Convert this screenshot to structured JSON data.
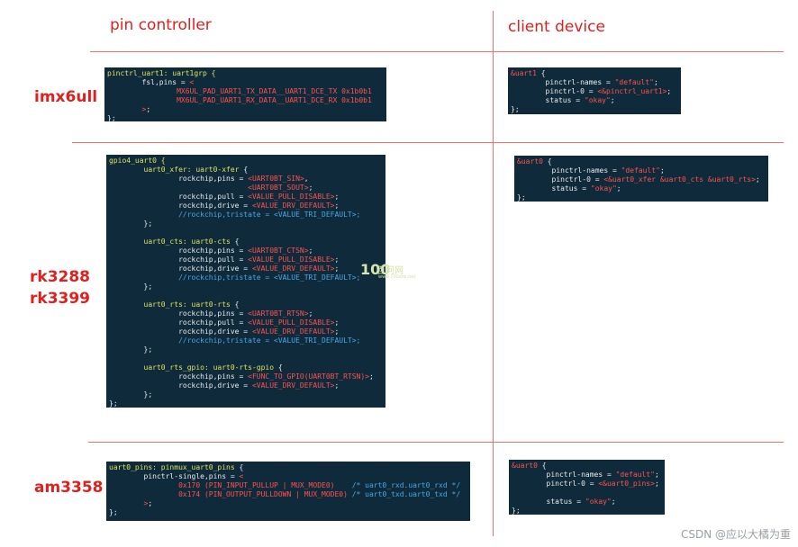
{
  "headers": {
    "left": "pin controller",
    "right": "client device"
  },
  "rows": [
    {
      "label_lines": [
        "imx6ull"
      ]
    },
    {
      "label_lines": [
        "rk3288",
        "rk3399"
      ]
    },
    {
      "label_lines": [
        "am3358"
      ]
    }
  ],
  "watermark": {
    "logo": "100",
    "text": "百问网",
    "url": "www.100ask.net"
  },
  "credit": "CSDN @应以大橘为重",
  "code_blocks": {
    "imx_pin": [
      [
        [
          "y",
          "pinctrl_uart1: uart1grp {"
        ]
      ],
      [
        [
          "w",
          "        fsl,pins = "
        ],
        [
          "r",
          "<"
        ]
      ],
      [
        [
          "r",
          "                MX6UL_PAD_UART1_TX_DATA__UART1_DCE_TX 0x1b0b1"
        ]
      ],
      [
        [
          "r",
          "                MX6UL_PAD_UART1_RX_DATA__UART1_DCE_RX 0x1b0b1"
        ]
      ],
      [
        [
          "r",
          "        >"
        ],
        [
          "w",
          ";"
        ]
      ],
      [
        [
          "w",
          "};"
        ]
      ]
    ],
    "imx_client": [
      [
        [
          "r",
          "&uart1"
        ],
        [
          "w",
          " {"
        ]
      ],
      [
        [
          "w",
          "        pinctrl-names = "
        ],
        [
          "r",
          "\"default\""
        ],
        [
          "w",
          ";"
        ]
      ],
      [
        [
          "w",
          "        pinctrl-0 = "
        ],
        [
          "r",
          "<&pinctrl_uart1>"
        ],
        [
          "w",
          ";"
        ]
      ],
      [
        [
          "w",
          "        status = "
        ],
        [
          "r",
          "\"okay\""
        ],
        [
          "w",
          ";"
        ]
      ],
      [
        [
          "w",
          "};"
        ]
      ]
    ],
    "rk_pin": [
      [
        [
          "y",
          "gpio4_uart0 {"
        ]
      ],
      [
        [
          "w",
          "        "
        ],
        [
          "y",
          "uart0_xfer: uart0-xfer"
        ],
        [
          "w",
          " {"
        ]
      ],
      [
        [
          "w",
          "                rockchip,pins = "
        ],
        [
          "r",
          "<UART0BT_SIN>"
        ],
        [
          "w",
          ","
        ]
      ],
      [
        [
          "w",
          "                                "
        ],
        [
          "r",
          "<UART0BT_SOUT>"
        ],
        [
          "w",
          ";"
        ]
      ],
      [
        [
          "w",
          "                rockchip,pull = "
        ],
        [
          "r",
          "<VALUE_PULL_DISABLE>"
        ],
        [
          "w",
          ";"
        ]
      ],
      [
        [
          "w",
          "                rockchip,drive = "
        ],
        [
          "r",
          "<VALUE_DRV_DEFAULT>"
        ],
        [
          "w",
          ";"
        ]
      ],
      [
        [
          "b",
          "                //rockchip,tristate = <VALUE_TRI_DEFAULT>;"
        ]
      ],
      [
        [
          "w",
          "        };"
        ]
      ],
      [
        [
          "w",
          ""
        ]
      ],
      [
        [
          "w",
          "        "
        ],
        [
          "y",
          "uart0_cts: uart0-cts"
        ],
        [
          "w",
          " {"
        ]
      ],
      [
        [
          "w",
          "                rockchip,pins = "
        ],
        [
          "r",
          "<UART0BT_CTSN>"
        ],
        [
          "w",
          ";"
        ]
      ],
      [
        [
          "w",
          "                rockchip,pull = "
        ],
        [
          "r",
          "<VALUE_PULL_DISABLE>"
        ],
        [
          "w",
          ";"
        ]
      ],
      [
        [
          "w",
          "                rockchip,drive = "
        ],
        [
          "r",
          "<VALUE_DRV_DEFAULT>"
        ],
        [
          "w",
          ";"
        ]
      ],
      [
        [
          "b",
          "                //rockchip,tristate = <VALUE_TRI_DEFAULT>;"
        ]
      ],
      [
        [
          "w",
          "        };"
        ]
      ],
      [
        [
          "w",
          ""
        ]
      ],
      [
        [
          "w",
          "        "
        ],
        [
          "y",
          "uart0_rts: uart0-rts"
        ],
        [
          "w",
          " {"
        ]
      ],
      [
        [
          "w",
          "                rockchip,pins = "
        ],
        [
          "r",
          "<UART0BT_RTSN>"
        ],
        [
          "w",
          ";"
        ]
      ],
      [
        [
          "w",
          "                rockchip,pull = "
        ],
        [
          "r",
          "<VALUE_PULL_DISABLE>"
        ],
        [
          "w",
          ";"
        ]
      ],
      [
        [
          "w",
          "                rockchip,drive = "
        ],
        [
          "r",
          "<VALUE_DRV_DEFAULT>"
        ],
        [
          "w",
          ";"
        ]
      ],
      [
        [
          "b",
          "                //rockchip,tristate = <VALUE_TRI_DEFAULT>;"
        ]
      ],
      [
        [
          "w",
          "        };"
        ]
      ],
      [
        [
          "w",
          ""
        ]
      ],
      [
        [
          "w",
          "        "
        ],
        [
          "y",
          "uart0_rts_gpio: uart0-rts-gpio"
        ],
        [
          "w",
          " {"
        ]
      ],
      [
        [
          "w",
          "                rockchip,pins = "
        ],
        [
          "r",
          "<FUNC_TO_GPIO(UART0BT_RTSN)>"
        ],
        [
          "w",
          ";"
        ]
      ],
      [
        [
          "w",
          "                rockchip,drive = "
        ],
        [
          "r",
          "<VALUE_DRV_DEFAULT>"
        ],
        [
          "w",
          ";"
        ]
      ],
      [
        [
          "w",
          "        };"
        ]
      ],
      [
        [
          "w",
          "};"
        ]
      ]
    ],
    "rk_client": [
      [
        [
          "r",
          "&uart0"
        ],
        [
          "w",
          " {"
        ]
      ],
      [
        [
          "w",
          "        pinctrl-names = "
        ],
        [
          "r",
          "\"default\""
        ],
        [
          "w",
          ";"
        ]
      ],
      [
        [
          "w",
          "        pinctrl-0 = "
        ],
        [
          "r",
          "<&uart0_xfer &uart0_cts &uart0_rts>"
        ],
        [
          "w",
          ";"
        ]
      ],
      [
        [
          "w",
          "        status = "
        ],
        [
          "r",
          "\"okay\""
        ],
        [
          "w",
          ";"
        ]
      ],
      [
        [
          "w",
          "};"
        ]
      ]
    ],
    "am_pin": [
      [
        [
          "y",
          "uart0_pins: pinmux_uart0_pins"
        ],
        [
          "w",
          " {"
        ]
      ],
      [
        [
          "w",
          "        pinctrl-single,pins = "
        ],
        [
          "r",
          "<"
        ]
      ],
      [
        [
          "r",
          "                0x170 (PIN_INPUT_PULLUP | MUX_MODE0)"
        ],
        [
          "b",
          "    /* uart0_rxd.uart0_rxd */"
        ]
      ],
      [
        [
          "r",
          "                0x174 (PIN_OUTPUT_PULLDOWN | MUX_MODE0)"
        ],
        [
          "b",
          " /* uart0_txd.uart0_txd */"
        ]
      ],
      [
        [
          "r",
          "        >"
        ],
        [
          "w",
          ";"
        ]
      ],
      [
        [
          "w",
          "};"
        ]
      ]
    ],
    "am_client": [
      [
        [
          "r",
          "&uart0"
        ],
        [
          "w",
          " {"
        ]
      ],
      [
        [
          "w",
          "        pinctrl-names = "
        ],
        [
          "r",
          "\"default\""
        ],
        [
          "w",
          ";"
        ]
      ],
      [
        [
          "w",
          "        pinctrl-0 = "
        ],
        [
          "r",
          "<&uart0_pins>"
        ],
        [
          "w",
          ";"
        ]
      ],
      [
        [
          "w",
          ""
        ]
      ],
      [
        [
          "w",
          "        status = "
        ],
        [
          "r",
          "\"okay\""
        ],
        [
          "w",
          ";"
        ]
      ],
      [
        [
          "w",
          "};"
        ]
      ]
    ]
  }
}
